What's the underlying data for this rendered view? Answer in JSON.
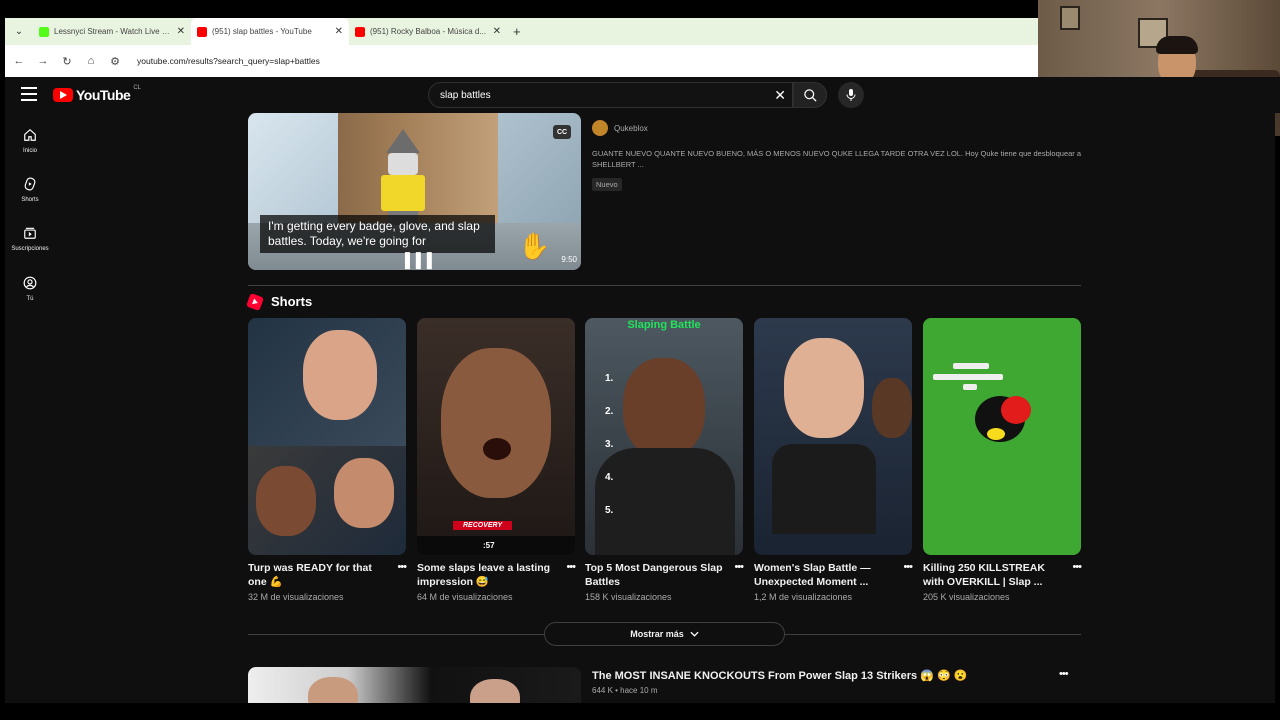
{
  "browser": {
    "tabs": [
      {
        "title": "Lessnyci Stream - Watch Live o...",
        "color": "#53fc18",
        "active": false
      },
      {
        "title": "(951) slap battles - YouTube",
        "color": "#ff0000",
        "active": true
      },
      {
        "title": "(951) Rocky Balboa - Música d...",
        "color": "#ff0000",
        "active": false
      }
    ],
    "url": "youtube.com/results?search_query=slap+battles"
  },
  "header": {
    "logo_text": "YouTube",
    "country": "CL",
    "search_value": "slap battles"
  },
  "sidebar": {
    "items": [
      {
        "label": "Inicio",
        "icon": "home-icon"
      },
      {
        "label": "Shorts",
        "icon": "shorts-icon"
      },
      {
        "label": "Suscripciones",
        "icon": "subscriptions-icon"
      },
      {
        "label": "Tú",
        "icon": "you-icon"
      }
    ]
  },
  "top_video": {
    "caption": "I'm getting every badge, glove, and slap battles. Today, we're going for",
    "cc": "CC",
    "duration": "9:50",
    "channel": "Qukeblox",
    "description": "GUANTE NUEVO QUANTE NUEVO BUENO, MÁS O MENOS NUEVO QUKE LLEGA TARDE OTRA VEZ LOL. Hoy Quke tiene que desbloquear a SHELLBERT ...",
    "badge": "Nuevo"
  },
  "shorts": {
    "heading": "Shorts",
    "items": [
      {
        "title": "Turp was READY for that one 💪",
        "views": "32 M de visualizaciones"
      },
      {
        "title": "Some slaps leave a lasting impression 😅",
        "views": "64 M de visualizaciones",
        "overlay": "RECOVERY",
        "score": ":57"
      },
      {
        "title": "Top 5 Most Dangerous Slap Battles",
        "views": "158 K visualizaciones",
        "overlay": "Slaping Battle"
      },
      {
        "title": "Women's Slap Battle — Unexpected Moment ...",
        "views": "1,2 M de visualizaciones"
      },
      {
        "title": "Killing 250 KILLSTREAK with OVERKILL | Slap ...",
        "views": "205 K visualizaciones"
      }
    ],
    "more_label": "Mostrar más"
  },
  "bottom_video": {
    "title": "The MOST INSANE KNOCKOUTS From Power Slap 13 Strikers 😱 😳 😮",
    "meta": "644 K • hace 10 m"
  },
  "colors": {
    "background": "#0f0f0f",
    "brand": "#ff0000",
    "text": "#f1f1f1",
    "muted": "#aaaaaa"
  }
}
